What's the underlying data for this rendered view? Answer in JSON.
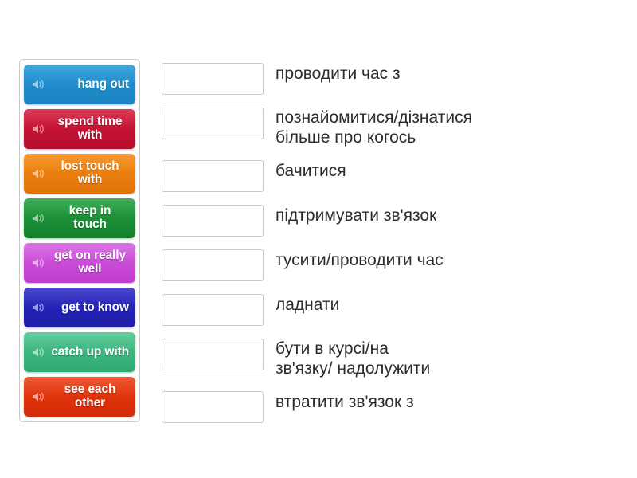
{
  "exercise": {
    "type": "match-the-pairs",
    "icon_name": "speaker-icon"
  },
  "tiles": [
    {
      "label": "hang out",
      "color": "#2196d6",
      "color_dark": "#1b84c0"
    },
    {
      "label": "spend\ntime with",
      "color": "#d6163a",
      "color_dark": "#b30f2d"
    },
    {
      "label": "lost touch\nwith",
      "color": "#f4870f",
      "color_dark": "#e0740a"
    },
    {
      "label": "keep in\ntouch",
      "color": "#1f9d3c",
      "color_dark": "#15812f"
    },
    {
      "label": "get on\nreally well",
      "color": "#d35de0",
      "color_dark": "#c03ccd"
    },
    {
      "label": "get to\nknow",
      "color": "#2a27c4",
      "color_dark": "#1f1da8"
    },
    {
      "label": "catch\nup with",
      "color": "#46c28a",
      "color_dark": "#30aa72"
    },
    {
      "label": "see each\nother",
      "color": "#ec3a10",
      "color_dark": "#d22c07"
    }
  ],
  "rows": [
    {
      "translation": "проводити час з"
    },
    {
      "translation": "познайомитися/дізнатися\nбільше про когось"
    },
    {
      "translation": "бачитися"
    },
    {
      "translation": "підтримувати зв'язок"
    },
    {
      "translation": "тусити/проводити час"
    },
    {
      "translation": "ладнати"
    },
    {
      "translation": "бути в курсі/на\nзв'язку/ надолужити"
    },
    {
      "translation": "втратити зв'язок з"
    }
  ]
}
